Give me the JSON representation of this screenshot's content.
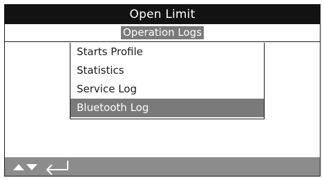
{
  "header": {
    "title": "Open Limit"
  },
  "subheader": {
    "label": "Operation Logs"
  },
  "menu": {
    "items": [
      {
        "label": "Starts Profile",
        "selected": false
      },
      {
        "label": "Statistics",
        "selected": false
      },
      {
        "label": "Service Log",
        "selected": false
      },
      {
        "label": "Bluetooth Log",
        "selected": true
      }
    ]
  },
  "nav": {
    "icons": [
      "up-arrow-icon",
      "down-arrow-icon",
      "enter-icon"
    ]
  },
  "colors": {
    "title_bg": "#121212",
    "highlight": "#7a7a7a",
    "nav_bg": "#8c8c8c",
    "text": "#1a1a1a"
  }
}
